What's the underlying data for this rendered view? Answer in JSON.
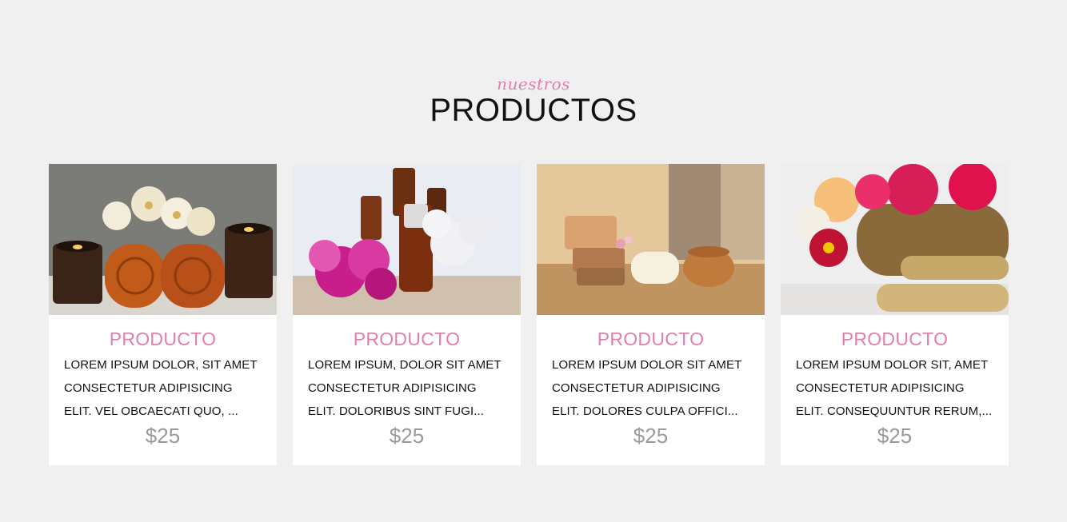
{
  "section": {
    "kicker": "nuestros",
    "title": "PRODUCTOS"
  },
  "products": [
    {
      "name": "PRODUCTO",
      "lines": [
        "LOREM IPSUM DOLOR, SIT AMET",
        "CONSECTETUR ADIPISICING",
        "ELIT. VEL OBCAECATI QUO, ..."
      ],
      "price": "$25",
      "image_alt": "spa towels with orchids and candles"
    },
    {
      "name": "PRODUCTO",
      "lines": [
        "LOREM IPSUM, DOLOR SIT AMET",
        "CONSECTETUR ADIPISICING",
        "ELIT. DOLORIBUS SINT FUGI..."
      ],
      "price": "$25",
      "image_alt": "essential oil bottles with flowers"
    },
    {
      "name": "PRODUCTO",
      "lines": [
        "LOREM IPSUM DOLOR SIT AMET",
        "CONSECTETUR ADIPISICING",
        "ELIT. DOLORES CULPA OFFICI..."
      ],
      "price": "$25",
      "image_alt": "handmade soaps with rolled towel and basket"
    },
    {
      "name": "PRODUCTO",
      "lines": [
        "LOREM IPSUM DOLOR SIT, AMET",
        "CONSECTETUR ADIPISICING",
        "ELIT. CONSEQUUNTUR RERUM,..."
      ],
      "price": "$25",
      "image_alt": "roses with bamboo sticks"
    }
  ]
}
